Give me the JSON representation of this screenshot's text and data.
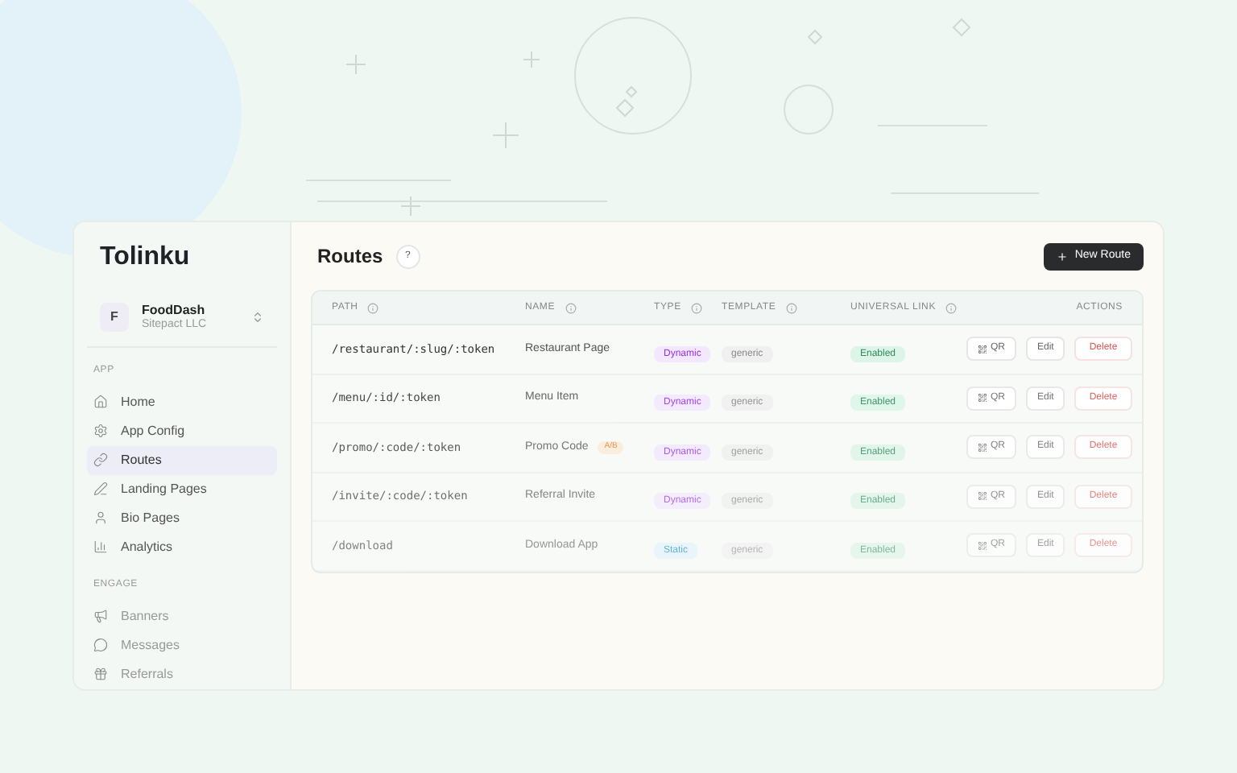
{
  "brand": "Tolinku",
  "workspace": {
    "initial": "F",
    "name": "FoodDash",
    "org": "Sitepact LLC"
  },
  "sidebar": {
    "sections": [
      {
        "title": "APP",
        "items": [
          {
            "label": "Home",
            "selected": false
          },
          {
            "label": "App Config",
            "selected": false
          },
          {
            "label": "Routes",
            "selected": true
          },
          {
            "label": "Landing Pages",
            "selected": false
          },
          {
            "label": "Bio Pages",
            "selected": false
          },
          {
            "label": "Analytics",
            "selected": false
          }
        ]
      },
      {
        "title": "ENGAGE",
        "items": [
          {
            "label": "Banners",
            "selected": false
          },
          {
            "label": "Messages",
            "selected": false
          },
          {
            "label": "Referrals",
            "selected": false
          }
        ]
      }
    ]
  },
  "page": {
    "title": "Routes",
    "help": "?",
    "new_button": "New Route"
  },
  "table": {
    "columns": [
      {
        "label": "PATH",
        "info": true
      },
      {
        "label": "NAME",
        "info": true
      },
      {
        "label": "TYPE",
        "info": true
      },
      {
        "label": "TEMPLATE",
        "info": true
      },
      {
        "label": "UNIVERSAL LINK",
        "info": true
      },
      {
        "label": "ACTIONS",
        "info": false
      }
    ],
    "rows": [
      {
        "path": "/restaurant/:slug/:token",
        "name": "Restaurant Page",
        "type": "Dynamic",
        "kind": "dynamic",
        "template": "generic",
        "link": "Enabled",
        "actions": [
          "QR",
          "Edit",
          "Delete"
        ]
      },
      {
        "path": "/menu/:id/:token",
        "name": "Menu Item",
        "type": "Dynamic",
        "kind": "dynamic",
        "template": "generic",
        "link": "Enabled",
        "actions": [
          "QR",
          "Edit",
          "Delete"
        ]
      },
      {
        "path": "/promo/:code/:token",
        "name": "Promo Code",
        "badge": "A/B",
        "type": "Dynamic",
        "kind": "dynamic",
        "template": "generic",
        "link": "Enabled",
        "actions": [
          "QR",
          "Edit",
          "Delete"
        ]
      },
      {
        "path": "/invite/:code/:token",
        "name": "Referral Invite",
        "type": "Dynamic",
        "kind": "dynamic",
        "template": "generic",
        "link": "Enabled",
        "actions": [
          "QR",
          "Edit",
          "Delete"
        ]
      },
      {
        "path": "/download",
        "name": "Download App",
        "type": "Static",
        "kind": "static",
        "template": "generic",
        "link": "Enabled",
        "actions": [
          "QR",
          "Edit",
          "Delete"
        ]
      }
    ]
  }
}
